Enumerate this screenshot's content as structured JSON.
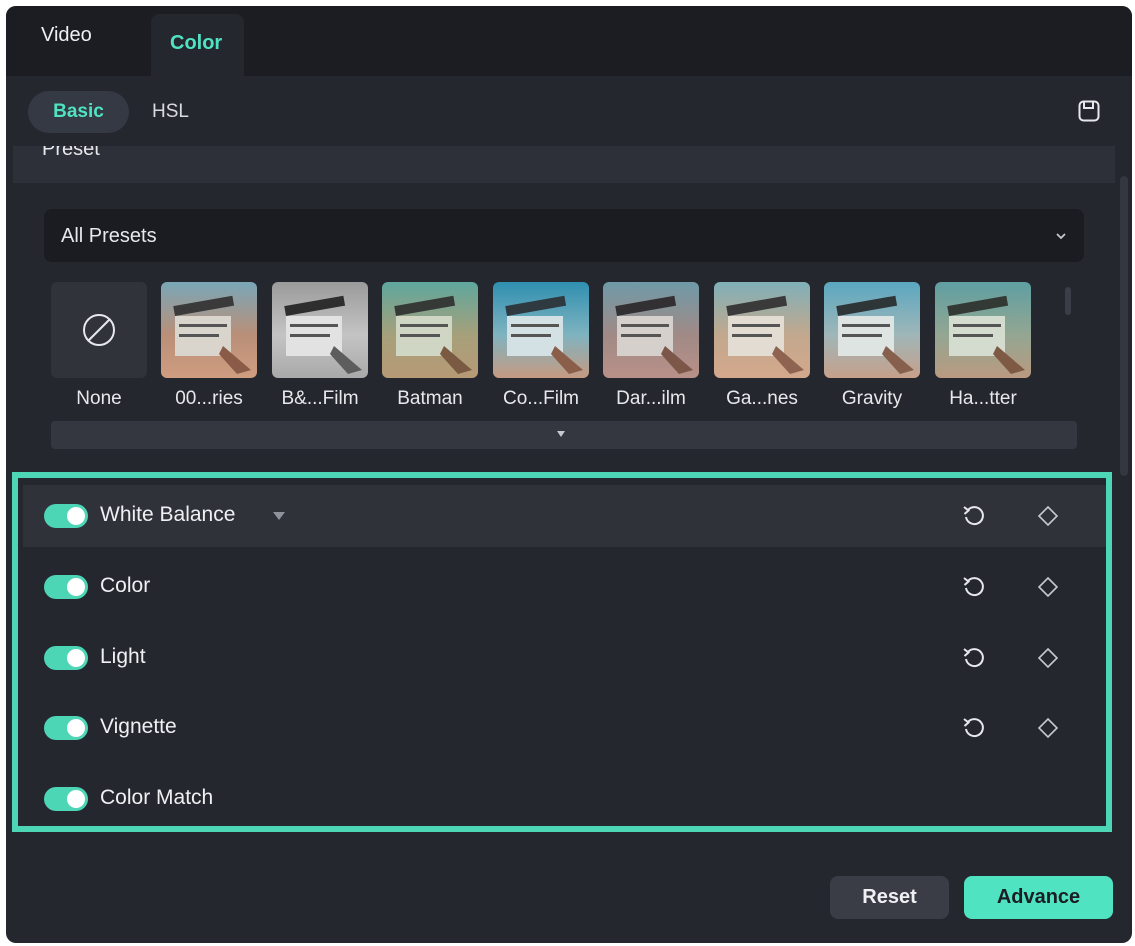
{
  "tabs": {
    "video": "Video",
    "color": "Color"
  },
  "subtabs": {
    "basic": "Basic",
    "hsl": "HSL"
  },
  "preset_section": {
    "title": "Preset"
  },
  "dropdown": {
    "selected": "All Presets"
  },
  "presets": [
    {
      "name": "None"
    },
    {
      "name": "00...ries"
    },
    {
      "name": "B&...Film"
    },
    {
      "name": "Batman"
    },
    {
      "name": "Co...Film"
    },
    {
      "name": "Dar...ilm"
    },
    {
      "name": "Ga...nes"
    },
    {
      "name": "Gravity"
    },
    {
      "name": "Ha...tter"
    }
  ],
  "adjustments": [
    {
      "label": "White Balance",
      "enabled": true
    },
    {
      "label": "Color",
      "enabled": true
    },
    {
      "label": "Light",
      "enabled": true
    },
    {
      "label": "Vignette",
      "enabled": true
    },
    {
      "label": "Color Match",
      "enabled": true
    }
  ],
  "buttons": {
    "reset": "Reset",
    "advance": "Advance"
  },
  "colors": {
    "accent": "#4fe3c2",
    "highlight_border": "#4dd6b6",
    "panel_bg": "#25272e"
  }
}
